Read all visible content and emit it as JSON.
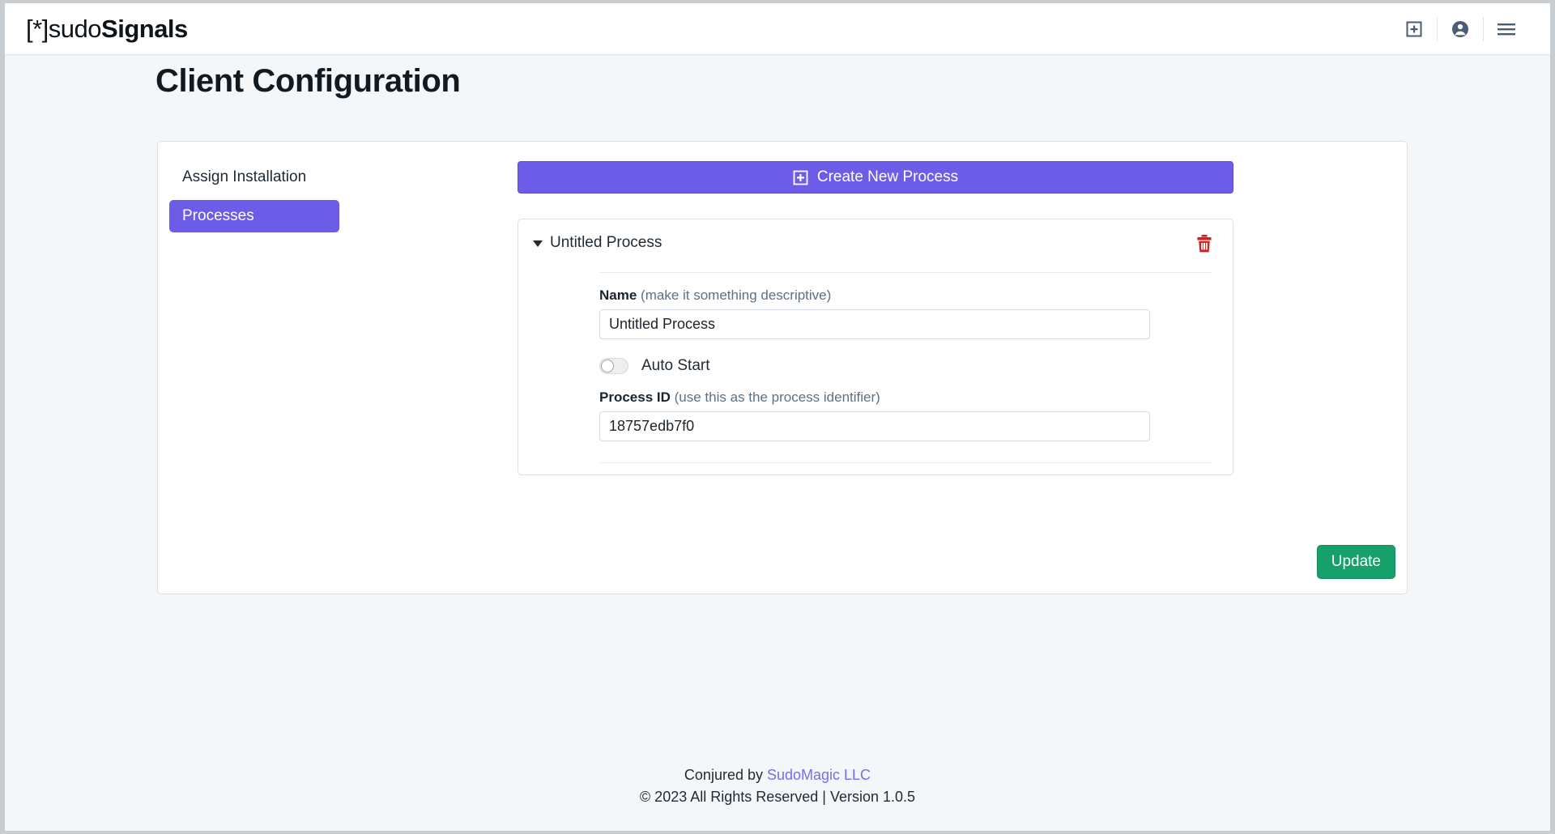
{
  "header": {
    "brand": {
      "bracket_open": "[*]",
      "light": "sudo",
      "bold": "Signals"
    },
    "icons": [
      {
        "name": "add-square-icon",
        "label": "Add"
      },
      {
        "name": "account-icon",
        "label": "Account"
      },
      {
        "name": "hamburger-menu-icon",
        "label": "Menu"
      }
    ]
  },
  "page": {
    "title": "Client Configuration"
  },
  "sidenav": {
    "items": [
      {
        "label": "Assign Installation",
        "active": false
      },
      {
        "label": "Processes",
        "active": true
      }
    ]
  },
  "main": {
    "create_button": {
      "label": "Create New Process",
      "icon": "plus-square-icon"
    },
    "process": {
      "header_title": "Untitled Process",
      "delete_icon": "trash-icon",
      "name_field": {
        "label": "Name",
        "hint": "(make it something descriptive)",
        "value": "Untitled Process",
        "placeholder": "Untitled Process"
      },
      "auto_start": {
        "label": "Auto Start",
        "checked": false
      },
      "process_id_field": {
        "label": "Process ID",
        "hint": "(use this as the process identifier)",
        "value": "18757edb7f0",
        "placeholder": "18757edb7f0"
      }
    },
    "update_button": {
      "label": "Update"
    }
  },
  "footer": {
    "line1_prefix": "Conjured by ",
    "line1_link": "SudoMagic LLC",
    "line2": "© 2023 All Rights Reserved | Version 1.0.5"
  },
  "colors": {
    "accent_purple": "#6c5ce7",
    "success_green": "#16a06a",
    "danger_red": "#cc2424",
    "page_background": "#f3f7f9",
    "header_icon": "#4a5d75"
  }
}
